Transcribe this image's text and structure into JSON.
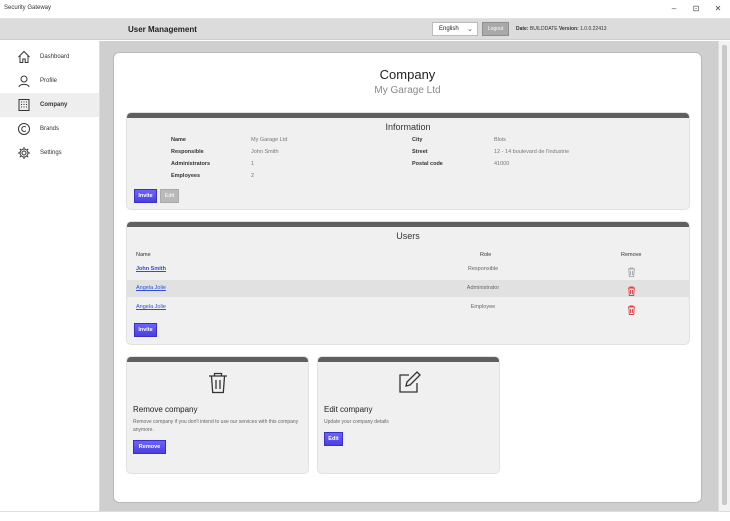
{
  "window": {
    "title": "Security Gateway",
    "minimize": "–",
    "maximize": "⊡",
    "close": "✕"
  },
  "header": {
    "title": "User Management",
    "language": "English",
    "logout_label": "Logout",
    "date_label": "Date:",
    "date_value": "BUILDDATE",
    "version_label": "Version:",
    "version_value": "1.0.0.22413"
  },
  "sidebar": {
    "items": [
      {
        "label": "Dashboard",
        "icon": "home-icon",
        "active": false
      },
      {
        "label": "Profile",
        "icon": "person-icon",
        "active": false
      },
      {
        "label": "Company",
        "icon": "building-icon",
        "active": true
      },
      {
        "label": "Brands",
        "icon": "copyright-icon",
        "active": false
      },
      {
        "label": "Settings",
        "icon": "gear-icon",
        "active": false
      }
    ]
  },
  "company": {
    "title": "Company",
    "name": "My Garage Ltd"
  },
  "information": {
    "title": "Information",
    "fields": {
      "name": {
        "label": "Name",
        "value": "My Garage Ltd"
      },
      "responsible": {
        "label": "Responsible",
        "value": "John Smith"
      },
      "administrators": {
        "label": "Administrators",
        "value": "1"
      },
      "employees": {
        "label": "Employees",
        "value": "2"
      },
      "city": {
        "label": "City",
        "value": "Blois"
      },
      "street": {
        "label": "Street",
        "value": "12 - 14 boulevard de l'industrie"
      },
      "postal_code": {
        "label": "Postal code",
        "value": "41000"
      }
    },
    "invite_label": "Invite",
    "edit_label": "Edit"
  },
  "users": {
    "title": "Users",
    "columns": {
      "name": "Name",
      "role": "Role",
      "remove": "Remove"
    },
    "rows": [
      {
        "name": "John Smith",
        "role": "Responsible"
      },
      {
        "name": "Angela Jolie",
        "role": "Administrator"
      },
      {
        "name": "Angela Jolie",
        "role": "Employee"
      }
    ],
    "invite_label": "Invite"
  },
  "remove_company": {
    "title": "Remove company",
    "description": "Remove company if you don't intend to use our services with this company anymore.",
    "button_label": "Remove"
  },
  "edit_company": {
    "title": "Edit company",
    "description": "Update your company details",
    "button_label": "Edit"
  },
  "colors": {
    "accent": "#4a3fe0",
    "card_header": "#5f5f5f",
    "danger": "#e04040",
    "link": "#2b4fd8"
  }
}
